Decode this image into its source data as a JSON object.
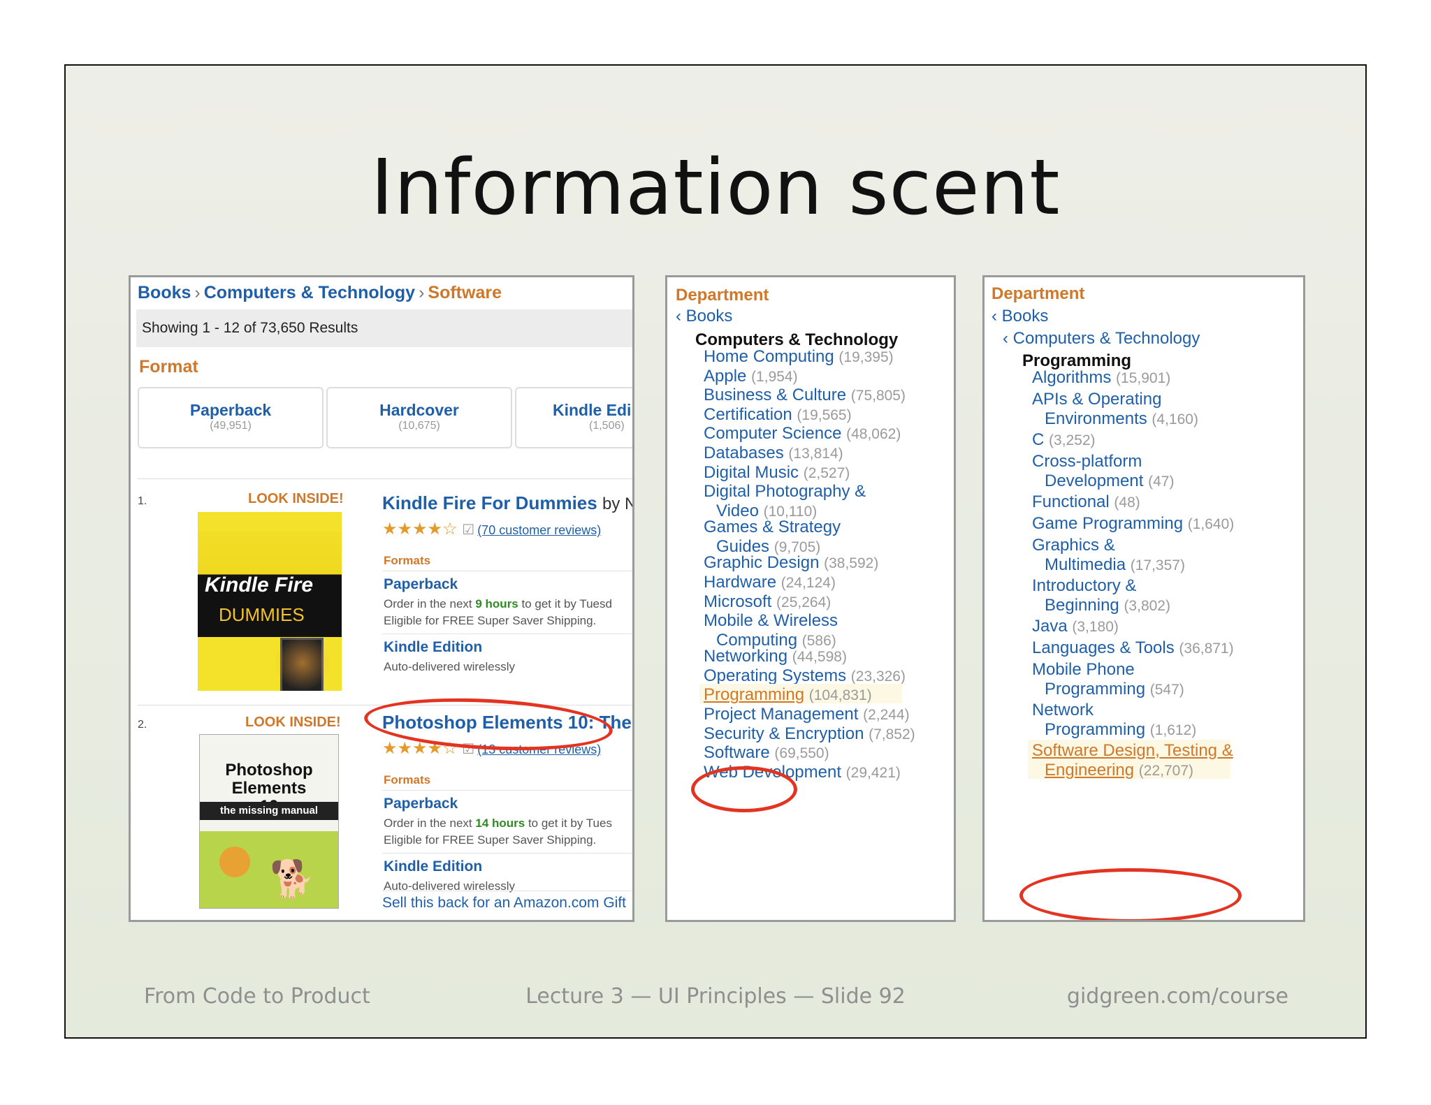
{
  "slide": {
    "title": "Information scent",
    "footer_left": "From Code to Product",
    "footer_center": "Lecture 3 — UI Principles — Slide 92",
    "footer_right": "gidgreen.com/course"
  },
  "panel1": {
    "breadcrumb": [
      "Books",
      "Computers & Technology",
      "Software"
    ],
    "showing": "Showing 1 - 12 of 73,650 Results",
    "format_heading": "Format",
    "formats": [
      {
        "name": "Paperback",
        "count": "(49,951)"
      },
      {
        "name": "Hardcover",
        "count": "(10,675)"
      },
      {
        "name": "Kindle Edi",
        "count": "(1,506)"
      }
    ],
    "results": [
      {
        "num": "1.",
        "look_inside": "LOOK INSIDE!",
        "cover_title": "Kindle Fire",
        "cover_subtitle": "DUMMIES",
        "title": "Kindle Fire For Dummies",
        "by": "by N",
        "reviews": "(70 customer reviews)",
        "formats_label": "Formats",
        "paperback": "Paperback",
        "order_pre": "Order in the next",
        "order_hours": "9 hours",
        "order_post": "to get it by Tuesd",
        "eligible": "Eligible for FREE Super Saver Shipping.",
        "kindle": "Kindle Edition",
        "auto": "Auto-delivered wirelessly"
      },
      {
        "num": "2.",
        "look_inside": "LOOK INSIDE!",
        "cover_title": "Photoshop Elements 10",
        "cover_subtitle": "the missing manual",
        "title": "Photoshop Elements 10: The",
        "reviews": "(13 customer reviews)",
        "formats_label": "Formats",
        "paperback": "Paperback",
        "order_pre": "Order in the next",
        "order_hours": "14 hours",
        "order_post": "to get it by Tues",
        "eligible": "Eligible for FREE Super Saver Shipping.",
        "kindle": "Kindle Edition",
        "auto": "Auto-delivered wirelessly",
        "sell": "Sell this back for an Amazon.com Gift"
      }
    ]
  },
  "panel2": {
    "department": "Department",
    "back": "‹ Books",
    "selected": "Computers & Technology",
    "items": [
      {
        "name": "Home Computing",
        "count": "(19,395)"
      },
      {
        "name": "Apple",
        "count": "(1,954)"
      },
      {
        "name": "Business & Culture",
        "count": "(75,805)"
      },
      {
        "name": "Certification",
        "count": "(19,565)"
      },
      {
        "name": "Computer Science",
        "count": "(48,062)"
      },
      {
        "name": "Databases",
        "count": "(13,814)"
      },
      {
        "name": "Digital Music",
        "count": "(2,527)"
      },
      {
        "name": "Digital Photography &",
        "name2": "Video",
        "count": "(10,110)"
      },
      {
        "name": "Games & Strategy",
        "name2": "Guides",
        "count": "(9,705)"
      },
      {
        "name": "Graphic Design",
        "count": "(38,592)"
      },
      {
        "name": "Hardware",
        "count": "(24,124)"
      },
      {
        "name": "Microsoft",
        "count": "(25,264)"
      },
      {
        "name": "Mobile & Wireless",
        "name2": "Computing",
        "count": "(586)"
      },
      {
        "name": "Networking",
        "count": "(44,598)"
      },
      {
        "name": "Operating Systems",
        "count": "(23,326)"
      },
      {
        "name": "Programming",
        "count": "(104,831)"
      },
      {
        "name": "Project Management",
        "count": "(2,244)"
      },
      {
        "name": "Security & Encryption",
        "count": "(7,852)"
      },
      {
        "name": "Software",
        "count": "(69,550)"
      },
      {
        "name": "Web Development",
        "count": "(29,421)"
      }
    ]
  },
  "panel3": {
    "department": "Department",
    "back1": "‹ Books",
    "back2": "‹ Computers & Technology",
    "selected": "Programming",
    "items": [
      {
        "name": "Algorithms",
        "count": "(15,901)"
      },
      {
        "name": "APIs & Operating",
        "name2": "Environments",
        "count": "(4,160)"
      },
      {
        "name": "C",
        "count": "(3,252)"
      },
      {
        "name": "Cross-platform",
        "name2": "Development",
        "count": "(47)"
      },
      {
        "name": "Functional",
        "count": "(48)"
      },
      {
        "name": "Game Programming",
        "count": "(1,640)"
      },
      {
        "name": "Graphics &",
        "name2": "Multimedia",
        "count": "(17,357)"
      },
      {
        "name": "Introductory &",
        "name2": "Beginning",
        "count": "(3,802)"
      },
      {
        "name": "Java",
        "count": "(3,180)"
      },
      {
        "name": "Languages & Tools",
        "count": "(36,871)"
      },
      {
        "name": "Mobile Phone",
        "name2": "Programming",
        "count": "(547)"
      },
      {
        "name": "Network",
        "name2": "Programming",
        "count": "(1,612)"
      },
      {
        "name": "Software Design, Testing &",
        "name2": "Engineering",
        "count": "(22,707)"
      }
    ]
  },
  "colors": {
    "link": "#1f5fa8",
    "accent": "#d0782a",
    "highlight_ring": "#e23420"
  }
}
